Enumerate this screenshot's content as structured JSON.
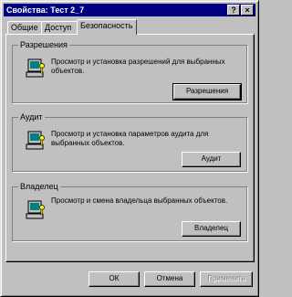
{
  "window": {
    "title": "Свойства: Тест 2_7",
    "help_button": "?",
    "close_button": "×"
  },
  "tabs": [
    {
      "label": "Общие"
    },
    {
      "label": "Доступ"
    },
    {
      "label": "Безопасность"
    }
  ],
  "active_tab": "Безопасность",
  "groups": {
    "permissions": {
      "label": "Разрешения",
      "description": "Просмотр и установка разрешений для выбранных объектов.",
      "button": "Разрешения"
    },
    "audit": {
      "label": "Аудит",
      "description": "Просмотр и установка параметров аудита для выбранных объектов.",
      "button": "Аудит"
    },
    "owner": {
      "label": "Владелец",
      "description": "Просмотр и смена владельца выбранных объектов.",
      "button": "Владелец"
    }
  },
  "footer": {
    "ok": "ОК",
    "cancel": "Отмена",
    "apply": "Применить"
  },
  "icons": {
    "permissions": "computer-key-icon",
    "audit": "computer-key-icon",
    "owner": "computer-key-icon"
  }
}
